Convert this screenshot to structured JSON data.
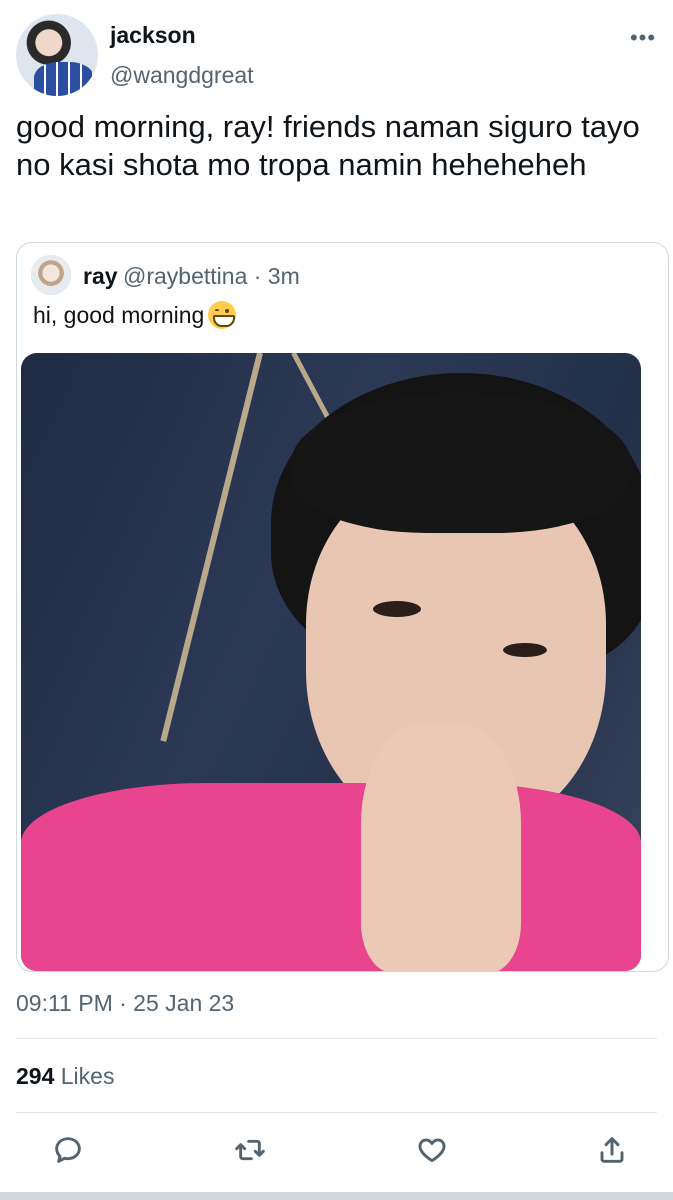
{
  "author": {
    "name": "jackson",
    "handle": "@wangdgreat"
  },
  "tweet": {
    "text": "good morning, ray! friends naman siguro tayo no kasi shota mo tropa namin heheheheh"
  },
  "quote": {
    "name": "ray",
    "handle_time": "@raybettina · 3m",
    "text": "hi, good morning",
    "emoji": "grinning-face-with-smiling-eyes"
  },
  "meta": {
    "timestamp": "09:11 PM · 25 Jan 23",
    "likes_count": "294",
    "likes_label": "Likes"
  },
  "icons": {
    "more": "more-icon",
    "reply": "reply-icon",
    "retweet": "retweet-icon",
    "like": "heart-icon",
    "share": "share-icon"
  },
  "colors": {
    "text_primary": "#0f1419",
    "text_secondary": "#536471",
    "border": "#cfd9de",
    "shirt_pink": "#e8458e"
  }
}
